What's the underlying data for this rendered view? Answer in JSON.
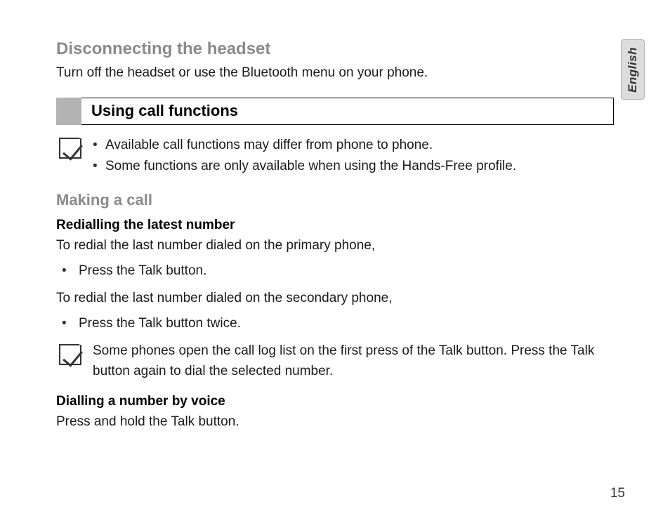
{
  "language_tab": "English",
  "section1": {
    "title": "Disconnecting the headset",
    "body": "Turn off the headset or use the Bluetooth menu on your phone."
  },
  "section2": {
    "title": "Using call functions",
    "notes": [
      "Available call functions may differ from phone to phone.",
      "Some functions are only available when using the Hands-Free profile."
    ]
  },
  "making_call": {
    "title": "Making a call",
    "redial_heading": "Redialling the latest number",
    "redial_primary_intro": "To redial the last number dialed on the primary phone,",
    "redial_primary_step": "Press the Talk button.",
    "redial_secondary_intro": "To redial the last number dialed on the secondary phone,",
    "redial_secondary_step": "Press the Talk button twice.",
    "note": "Some phones open the call log list on the first press of the Talk button. Press the Talk button again to dial the selected number.",
    "voice_heading": "Dialling a number by voice",
    "voice_body": "Press and hold the Talk button."
  },
  "page_number": "15"
}
